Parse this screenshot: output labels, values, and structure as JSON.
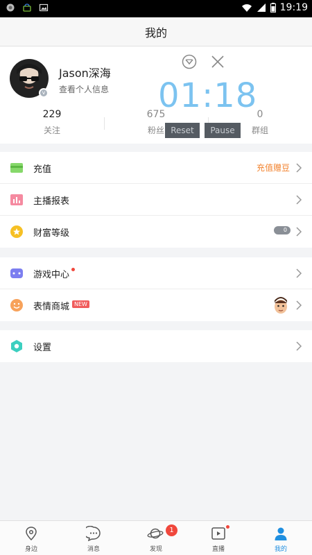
{
  "status_bar": {
    "time": "19:19",
    "left_icons": [
      "notification-icon",
      "android-icon",
      "image-icon"
    ],
    "right_icons": [
      "wifi-icon",
      "signal-icon",
      "battery-icon"
    ]
  },
  "header": {
    "title": "我的"
  },
  "profile": {
    "username": "Jason深海",
    "subtitle": "查看个人信息",
    "stats": [
      {
        "value": "229",
        "label": "关注"
      },
      {
        "value": "675",
        "label": "粉丝"
      },
      {
        "value": "0",
        "label": "群组"
      }
    ]
  },
  "timer": {
    "time": "01:18",
    "reset_label": "Reset",
    "pause_label": "Pause",
    "color": "#7cc3f0"
  },
  "section1": [
    {
      "label": "充值",
      "extra": "充值赠豆",
      "icon": "card-icon"
    },
    {
      "label": "主播报表",
      "icon": "report-icon"
    },
    {
      "label": "财富等级",
      "extra": "0",
      "icon": "star-icon"
    }
  ],
  "section2": [
    {
      "label": "游戏中心",
      "icon": "gamepad-icon"
    },
    {
      "label": "表情商城",
      "badge": "NEW",
      "icon": "smile-icon"
    }
  ],
  "section3": [
    {
      "label": "设置",
      "icon": "settings-icon"
    }
  ],
  "bottom_nav": [
    {
      "label": "身边",
      "icon": "location-pin-icon"
    },
    {
      "label": "消息",
      "icon": "chat-icon"
    },
    {
      "label": "发现",
      "icon": "planet-icon",
      "badge": "1"
    },
    {
      "label": "直播",
      "icon": "live-video-icon"
    },
    {
      "label": "我的",
      "icon": "person-icon",
      "active": true
    }
  ],
  "colors": {
    "accent": "#1f8fe0",
    "orange_text": "#f2832f",
    "badge_red": "#f05b5b"
  }
}
